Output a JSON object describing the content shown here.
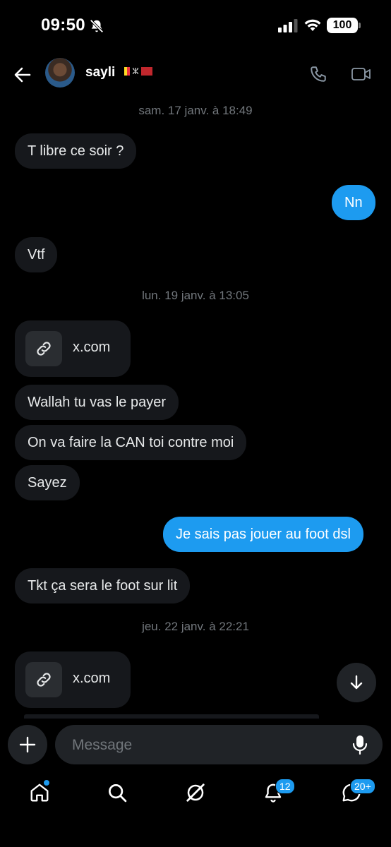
{
  "status_bar": {
    "time": "09:50",
    "battery": "100"
  },
  "header": {
    "contact_name": "sayli",
    "flags_text": "ⵣ"
  },
  "messages": {
    "date1": "sam. 17 janv. à 18:49",
    "m1": "T libre ce soir ?",
    "m2": "Nn",
    "m3": "Vtf",
    "date2": "lun. 19 janv. à 13:05",
    "link1": "x.com",
    "m4": "Wallah tu vas le payer",
    "m5": "On va faire la CAN toi contre moi",
    "m6": "Sayez",
    "m7": "Je sais pas jouer au foot dsl",
    "m8": "Tkt ça sera le foot sur lit",
    "date3": "jeu. 22 janv. à 22:21",
    "link2": "x.com"
  },
  "composer": {
    "placeholder": "Message"
  },
  "nav": {
    "notifications_badge": "12",
    "messages_badge": "20+"
  },
  "colors": {
    "accent": "#1d9bf0",
    "bubble_in": "#16181c",
    "background": "#000000",
    "muted": "#71767b"
  }
}
